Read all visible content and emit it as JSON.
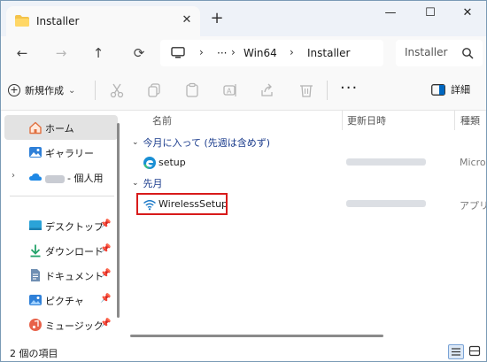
{
  "window": {
    "tab_title": "Installer",
    "close_tab_symbol": "✕",
    "new_tab_symbol": "+",
    "minimize_symbol": "—",
    "maximize_symbol": "☐",
    "close_symbol": "✕"
  },
  "address_bar": {
    "back_symbol": "←",
    "forward_symbol": "→",
    "up_symbol": "↑",
    "refresh_symbol": "⟳",
    "separator": "›",
    "ellipsis": "···",
    "crumbs": [
      "Win64",
      "Installer"
    ],
    "search_placeholder": "Installer"
  },
  "command_bar": {
    "new_label": "新規作成",
    "new_chevron": "⌄",
    "more_symbol": "···",
    "details_label": "詳細"
  },
  "sidebar": {
    "items": [
      {
        "label": "ホーム",
        "icon": "home-icon"
      },
      {
        "label": "ギャラリー",
        "icon": "gallery-icon"
      },
      {
        "label": "- 個人用",
        "icon": "onedrive-icon"
      },
      {
        "label": "デスクトップ",
        "icon": "desktop-icon"
      },
      {
        "label": "ダウンロード",
        "icon": "download-icon"
      },
      {
        "label": "ドキュメント",
        "icon": "documents-icon"
      },
      {
        "label": "ピクチャ",
        "icon": "pictures-icon"
      },
      {
        "label": "ミュージック",
        "icon": "music-icon"
      }
    ],
    "expander_symbol": "›",
    "pin_symbol": "📌"
  },
  "content": {
    "columns": {
      "name": "名前",
      "date": "更新日時",
      "type": "種類"
    },
    "groups": [
      {
        "label": "今月に入って (先週は含めず)",
        "files": [
          {
            "name": "setup",
            "type": "Micros",
            "icon": "edge-icon"
          }
        ]
      },
      {
        "label": "先月",
        "files": [
          {
            "name": "WirelessSetup",
            "type": "アプリケ",
            "icon": "wifi-icon"
          }
        ]
      }
    ],
    "group_chevron": "⌄",
    "sort_chevron": "⌃"
  },
  "status": {
    "item_count": "2 個の項目"
  },
  "colors": {
    "accent": "#0067c0",
    "highlight_border": "#d81b1b",
    "group_text": "#1a3b8c"
  }
}
